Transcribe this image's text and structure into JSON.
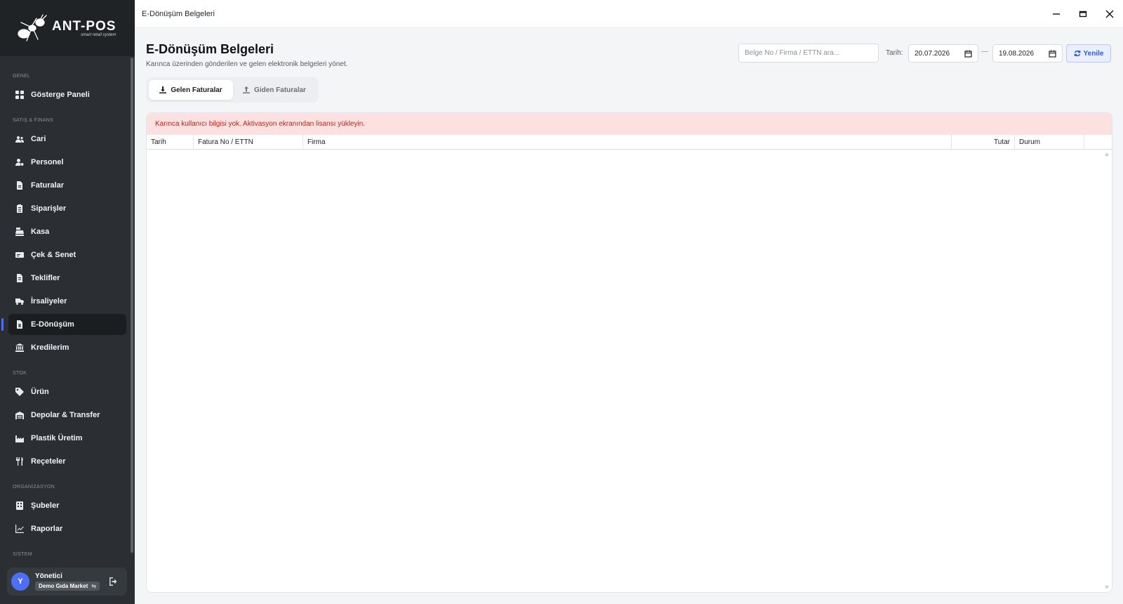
{
  "app": {
    "logo_title": "ANT-POS",
    "logo_subtitle": "smart retail system",
    "window_title": "E-Dönüşüm Belgeleri"
  },
  "sidebar": {
    "sections": {
      "genel": "GENEL",
      "satis": "SATIŞ & FİNANS",
      "stok": "STOK",
      "org": "ORGANİZASYON",
      "sistem": "SİSTEM"
    },
    "items": {
      "dashboard": "Gösterge Paneli",
      "cari": "Cari",
      "personel": "Personel",
      "faturalar": "Faturalar",
      "siparisler": "Siparişler",
      "kasa": "Kasa",
      "cek": "Çek & Senet",
      "teklifler": "Teklifler",
      "irsaliyeler": "İrsaliyeler",
      "edonusum": "E-Dönüşüm",
      "kredilerim": "Kredilerim",
      "urun": "Ürün",
      "depolar": "Depolar & Transfer",
      "plastik": "Plastik Üretim",
      "receteler": "Reçeteler",
      "subeler": "Şubeler",
      "raporlar": "Raporlar"
    },
    "active": "E-Dönüşüm",
    "user": {
      "initial": "Y",
      "name": "Yönetici",
      "company": "Demo Gıda Market"
    }
  },
  "page": {
    "title": "E-Dönüşüm Belgeleri",
    "subtitle": "Karınca üzerinden gönderilen ve gelen elektronik belgeleri yönet.",
    "search_placeholder": "Belge No / Firma / ETTN ara...",
    "date_label": "Tarih:",
    "date_from": "20.07.2026",
    "date_separator": "—",
    "date_to": "19.08.2026",
    "refresh_label": "Yenile"
  },
  "tabs": {
    "incoming": "Gelen Faturalar",
    "outgoing": "Giden Faturalar",
    "active": "Gelen Faturalar"
  },
  "alert": {
    "message": "Karınca kullanıcı bilgisi yok. Aktivasyon ekranından lisansı yükleyin."
  },
  "table": {
    "columns": {
      "date": "Tarih",
      "invoice": "Fatura No / ETTN",
      "company": "Firma",
      "amount": "Tutar",
      "status": "Durum"
    },
    "rows": []
  },
  "colors": {
    "sidebar_bg": "#2b2f33",
    "accent": "#4f6ef7",
    "alert_bg": "#fde1e1",
    "alert_text": "#b3261e"
  }
}
